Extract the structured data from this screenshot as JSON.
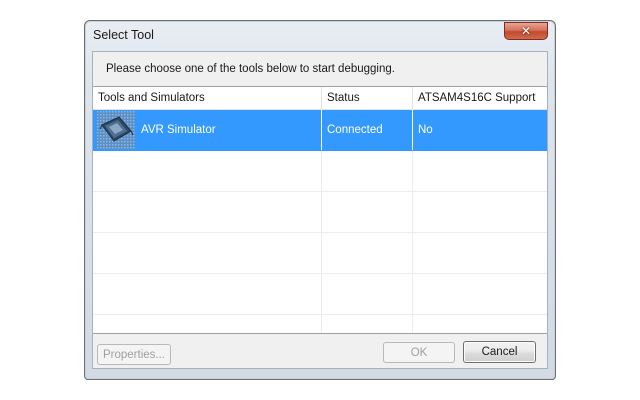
{
  "window": {
    "title": "Select Tool",
    "close_glyph": "✕"
  },
  "instruction": "Please choose one of the tools below to start debugging.",
  "table": {
    "columns": [
      "Tools and Simulators",
      "Status",
      "ATSAM4S16C Support"
    ],
    "rows": [
      {
        "icon": "avr-simulator-chip-icon",
        "tool": "AVR Simulator",
        "status": "Connected",
        "support": "No",
        "selected": true
      }
    ]
  },
  "buttons": {
    "properties": "Properties...",
    "ok": "OK",
    "cancel": "Cancel"
  },
  "colors": {
    "selection": "#3399ff",
    "close_button": "#c8533a"
  }
}
